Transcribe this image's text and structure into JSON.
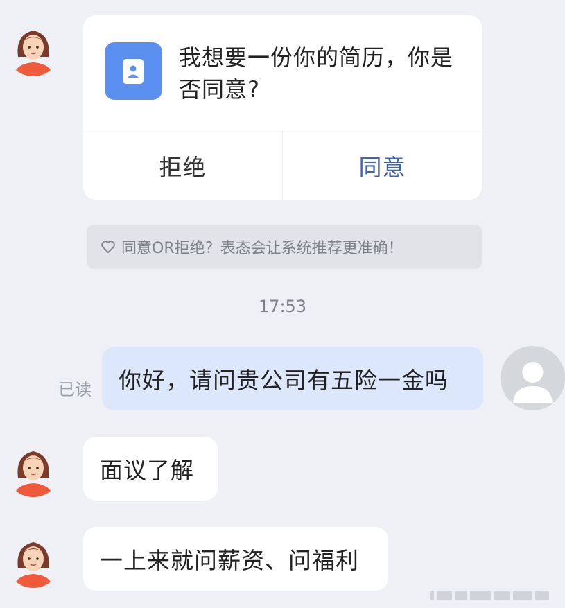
{
  "card": {
    "question": "我想要一份你的简历，你是否同意?",
    "reject_label": "拒绝",
    "agree_label": "同意",
    "icon": "resume-icon"
  },
  "hint": {
    "icon": "heart-icon",
    "text": "同意OR拒绝？表态会让系统推荐更准确！"
  },
  "timestamp": "17:53",
  "messages": [
    {
      "from": "me",
      "status": "已读",
      "text": "你好，请问贵公司有五险一金吗"
    },
    {
      "from": "recruiter",
      "text": "面议了解"
    },
    {
      "from": "recruiter",
      "text": "一上来就问薪资、问福利"
    }
  ],
  "colors": {
    "background": "#eef0f5",
    "agree_accent": "#3f64b5",
    "my_bubble": "#dde7fb",
    "resume_icon_bg": "#5b8ff0"
  }
}
